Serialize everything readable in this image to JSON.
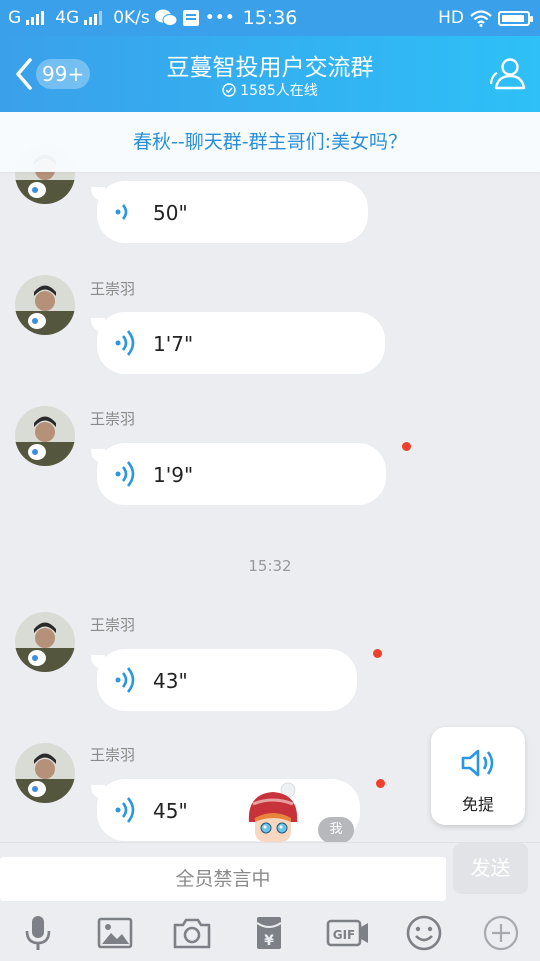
{
  "status_bar": {
    "carrier_g": "G",
    "network": "4G",
    "speed": "0K/s",
    "more": "•••",
    "time": "15:36",
    "hd": "HD"
  },
  "header": {
    "unread_count": "99+",
    "title": "豆蔓智投用户交流群",
    "online": "1585人在线"
  },
  "notice": "春秋--聊天群-群主哥们:美女吗？",
  "messages": [
    {
      "sender": "",
      "duration": "50\""
    },
    {
      "sender": "王崇羽",
      "duration": "1'7\""
    },
    {
      "sender": "王崇羽",
      "duration": "1'9\""
    },
    {
      "sender": "王崇羽",
      "duration": "43\""
    },
    {
      "sender": "王崇羽",
      "duration": "45\""
    }
  ],
  "timestamp": "15:32",
  "me_tag": "我",
  "float_button": {
    "label": "免提",
    "icon": "speaker-icon"
  },
  "input": {
    "placeholder": "全员禁言中",
    "send_label": "发送"
  },
  "toolbar_icons": [
    "mic-icon",
    "image-icon",
    "camera-icon",
    "red-packet-icon",
    "gif-icon",
    "emoji-icon",
    "plus-icon"
  ],
  "colors": {
    "header": "#3aa0ea",
    "unread_dot": "#f0402b",
    "notice_text": "#2a8fd8",
    "voice_wave": "#2a96e4"
  }
}
